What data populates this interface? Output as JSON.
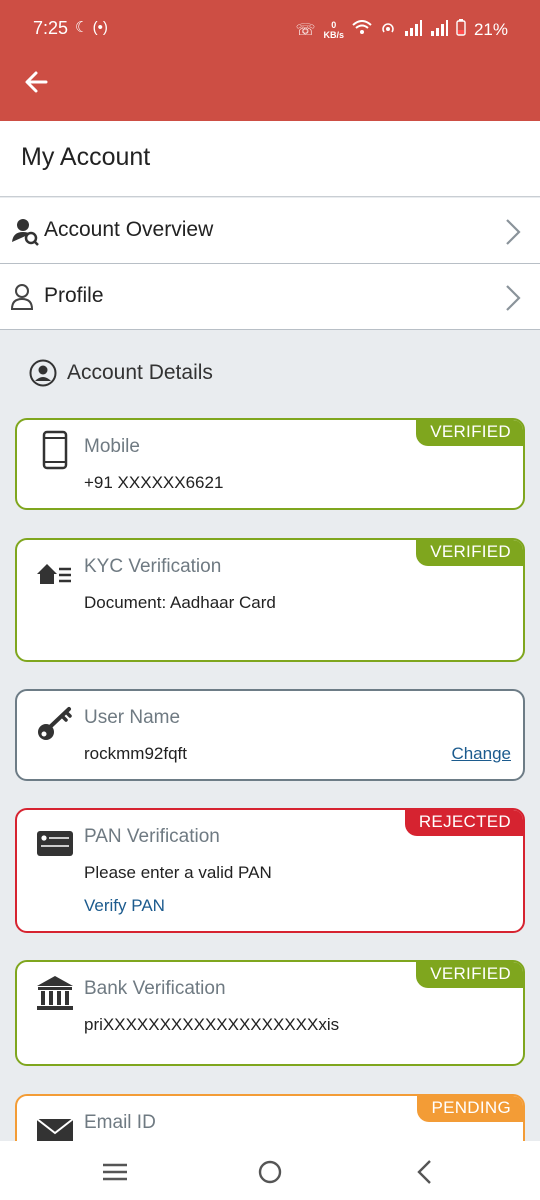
{
  "status_bar": {
    "time": "7:25",
    "left_icons": "☾ (•)",
    "net_speed_value": "0",
    "net_speed_unit": "KB/s",
    "battery": "21%"
  },
  "header": {
    "back_icon": "arrow-left-icon"
  },
  "page": {
    "title": "My Account"
  },
  "nav": [
    {
      "label": "Account Overview",
      "icon": "user-search-icon"
    },
    {
      "label": "Profile",
      "icon": "user-icon"
    }
  ],
  "section": {
    "label": "Account Details"
  },
  "cards": {
    "mobile": {
      "title": "Mobile",
      "value": "+91 XXXXXX6621",
      "status": "VERIFIED"
    },
    "kyc": {
      "title": "KYC Verification",
      "value": "Document: Aadhaar Card",
      "status": "VERIFIED"
    },
    "username": {
      "title": "User Name",
      "value": "rockmm92fqft",
      "action": "Change"
    },
    "pan": {
      "title": "PAN Verification",
      "value": "Please enter a valid PAN",
      "action": "Verify PAN",
      "status": "REJECTED"
    },
    "bank": {
      "title": "Bank Verification",
      "value": "priXXXXXXXXXXXXXXXXXXXxis",
      "status": "VERIFIED"
    },
    "email": {
      "title": "Email ID",
      "status": "PENDING"
    }
  },
  "colors": {
    "header": "#cd4e44",
    "verified": "#7fa61e",
    "rejected": "#d62330",
    "pending": "#f39c36",
    "link": "#1c5b8e"
  }
}
